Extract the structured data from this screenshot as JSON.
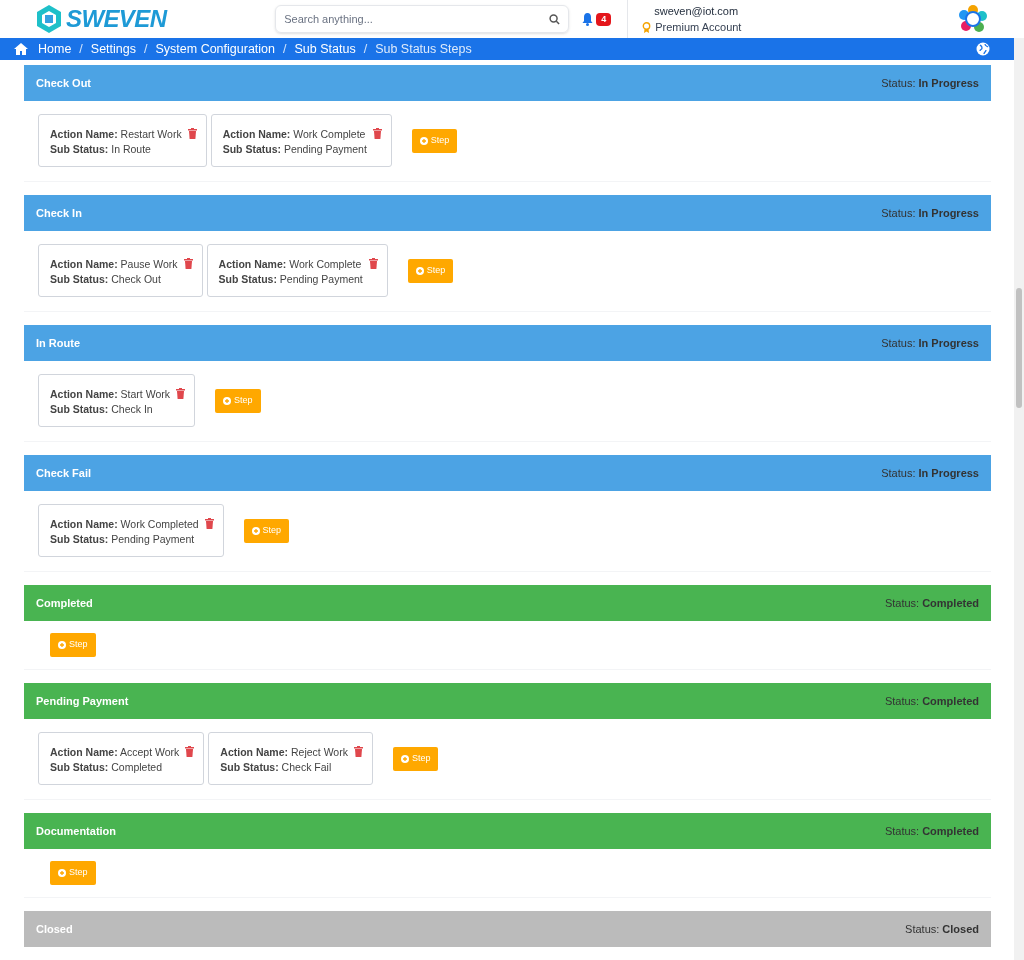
{
  "header": {
    "logo_text": "SWEVEN",
    "search": {
      "placeholder": "Search anything..."
    },
    "notification_count": "4",
    "user_email": "sweven@iot.com",
    "account_type": "Premium Account"
  },
  "breadcrumb": [
    {
      "label": "Home"
    },
    {
      "separator": "/",
      "label": "Settings"
    },
    {
      "separator": "/",
      "label": "System Configuration"
    },
    {
      "separator": "/",
      "label": "Sub Status"
    },
    {
      "separator": "/",
      "label": "Sub Status Steps"
    }
  ],
  "sections": [
    {
      "title": "Check Out",
      "kind": "in_progress",
      "status_label": "Status:",
      "status": "In Progress",
      "steps": [
        {
          "action": "**Action Name:** Restart Work",
          "sub_status": "**Sub Status:** In Route"
        },
        {
          "action": "**Action Name:** Work Complete",
          "sub_status": "**Sub Status:** Pending Payment"
        }
      ],
      "step_button": "Step"
    },
    {
      "title": "Check In",
      "kind": "in_progress",
      "status_label": "Status:",
      "status": "In Progress",
      "steps": [
        {
          "action": "**Action Name:** Pause Work",
          "sub_status": "**Sub Status:** Check Out"
        },
        {
          "action": "**Action Name:** Work Complete",
          "sub_status": "**Sub Status:** Pending Payment"
        }
      ],
      "step_button": "Step"
    },
    {
      "title": "In Route",
      "kind": "in_progress",
      "status_label": "Status:",
      "status": "In Progress",
      "steps": [
        {
          "action": "**Action Name:** Start Work",
          "sub_status": "**Sub Status:** Check In"
        }
      ],
      "step_button": "Step"
    },
    {
      "title": "Check Fail",
      "kind": "in_progress",
      "status_label": "Status:",
      "status": "In Progress",
      "steps": [
        {
          "action": "**Action Name:** Work Completed",
          "sub_status": "**Sub Status:** Pending Payment"
        }
      ],
      "step_button": "Step"
    },
    {
      "title": "Completed",
      "kind": "completed",
      "status_label": "Status:",
      "status": "Completed",
      "step_button": "Step"
    },
    {
      "title": "Pending Payment",
      "kind": "completed",
      "status_label": "Status:",
      "status": "Completed",
      "steps": [
        {
          "action": "**Action Name:** Accept Work",
          "sub_status": "**Sub Status:** Completed"
        },
        {
          "action": "**Action Name:** Reject Work",
          "sub_status": "**Sub Status:** Check Fail"
        }
      ],
      "step_button": "Step"
    },
    {
      "title": "Documentation",
      "kind": "completed",
      "status_label": "Status:",
      "status": "Completed",
      "step_button": "Step"
    },
    {
      "title": "Closed",
      "kind": "closed",
      "status_label": "Status:",
      "status": "Closed"
    }
  ]
}
